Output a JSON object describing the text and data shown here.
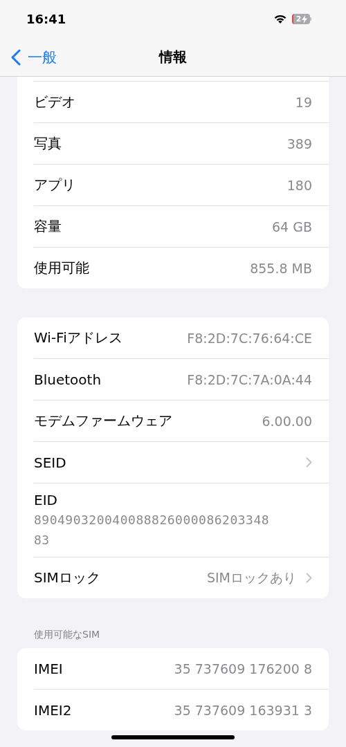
{
  "status_bar": {
    "time": "16:41",
    "battery_text": "2",
    "charging": true
  },
  "nav": {
    "back": "一般",
    "title": "情報"
  },
  "groups": [
    {
      "clipped_top": true,
      "rows": [
        {
          "kind": "value",
          "label": "ビデオ",
          "value": "19"
        },
        {
          "kind": "value",
          "label": "写真",
          "value": "389"
        },
        {
          "kind": "value",
          "label": "アプリ",
          "value": "180"
        },
        {
          "kind": "value",
          "label": "容量",
          "value": "64 GB"
        },
        {
          "kind": "value",
          "label": "使用可能",
          "value": "855.8 MB"
        }
      ]
    },
    {
      "clipped_top": false,
      "rows": [
        {
          "kind": "value",
          "label": "Wi-Fiアドレス",
          "value": "F8:2D:7C:76:64:CE"
        },
        {
          "kind": "value",
          "label": "Bluetooth",
          "value": "F8:2D:7C:7A:0A:44"
        },
        {
          "kind": "value",
          "label": "モデムファームウェア",
          "value": "6.00.00"
        },
        {
          "kind": "chevron",
          "label": "SEID"
        },
        {
          "kind": "stacked",
          "label": "EID",
          "value": "890490320040088826000086203348",
          "value_line2": "83"
        },
        {
          "kind": "value_chevron",
          "label": "SIMロック",
          "value": "SIMロックあり"
        }
      ]
    },
    {
      "header": "使用可能なSIM",
      "clipped_top": false,
      "rows": [
        {
          "kind": "value",
          "label": "IMEI",
          "value": "35 737609 176200 8"
        },
        {
          "kind": "value",
          "label": "IMEI2",
          "value": "35 737609 163931 3"
        }
      ]
    }
  ]
}
